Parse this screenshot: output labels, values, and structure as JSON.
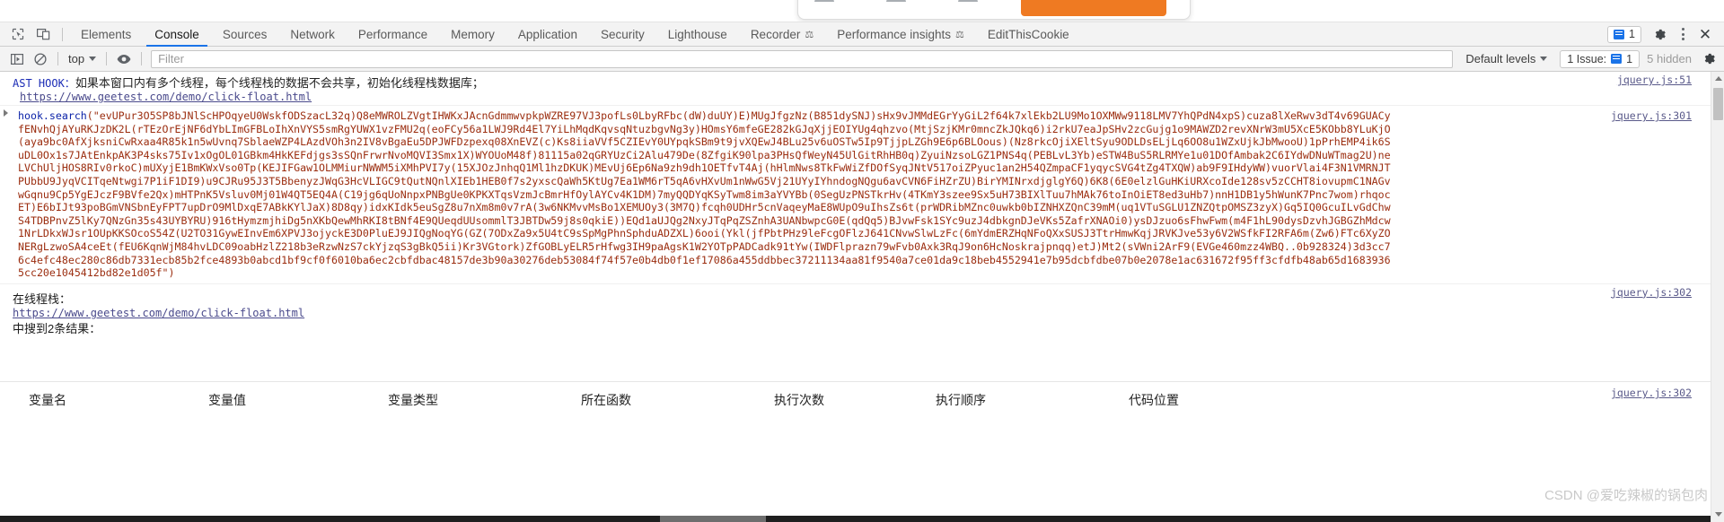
{
  "popup": {
    "orange_button_label": ""
  },
  "tabbar": {
    "inspect_icon": "inspect-cursor-icon",
    "device_icon": "device-toolbar-icon",
    "tabs": [
      {
        "label": "Elements",
        "selected": false,
        "flask": false
      },
      {
        "label": "Console",
        "selected": true,
        "flask": false
      },
      {
        "label": "Sources",
        "selected": false,
        "flask": false
      },
      {
        "label": "Network",
        "selected": false,
        "flask": false
      },
      {
        "label": "Performance",
        "selected": false,
        "flask": false
      },
      {
        "label": "Memory",
        "selected": false,
        "flask": false
      },
      {
        "label": "Application",
        "selected": false,
        "flask": false
      },
      {
        "label": "Security",
        "selected": false,
        "flask": false
      },
      {
        "label": "Lighthouse",
        "selected": false,
        "flask": false
      },
      {
        "label": "Recorder",
        "selected": false,
        "flask": true
      },
      {
        "label": "Performance insights",
        "selected": false,
        "flask": true
      },
      {
        "label": "EditThisCookie",
        "selected": false,
        "flask": false
      }
    ],
    "issue_count": "1",
    "settings_icon": "gear-icon",
    "more_icon": "kebab-menu-icon",
    "close_icon": "close-icon",
    "close_glyph": "✕"
  },
  "toolbar": {
    "clear_icon": "clear-console-icon",
    "noentry_icon": "no-entry-icon",
    "context": "top",
    "eye_icon": "live-expression-eye-icon",
    "filter_placeholder": "Filter",
    "levels_label": "Default levels",
    "issues_label": "1 Issue:",
    "issues_count": "1",
    "hidden_label": "5 hidden",
    "settings_icon": "console-settings-gear-icon"
  },
  "console": {
    "messages": [
      {
        "id": "ast-hook",
        "prefix": "AST HOOK：",
        "text": "如果本窗口内有多个线程，每个线程栈的数据不会共享，初始化线程栈数据库；",
        "source": "jquery.js:51",
        "link": "https://www.geetest.com/demo/click-float.html"
      },
      {
        "id": "hook-search",
        "fn": "hook.search",
        "code": "(\"evUPur3O5SP8bJNlScHPOqyeU0WskfODSzacL32q)Q8eMWROLZVgtIHWKxJAcnGdmmwvpkpWZRE97VJ3pofLs0LbyRFbc(dW)duUY)E)MUgJfgzNz(B851dySNJ)sHx9vJMMdEGrYyGiL2f64k7xlEkb2LU9Mo1OXMWw9118LMV7YhQPdN4xpS)cuza8lXeRwv3dT4v69GUACyfENvhQjAYuRKJzDK2L(rTEzOrEjNF6dYbLImGFBLoIhXnVYS5smRgYUWX1vzFMU2q(eoFCy56a1LWJ9Rd4El7YiLhMqdKqvsqNtuzbgvNg3y)HOmsY6mfeGE282kGJqXjjEOIYUg4qhzvo(MtjSzjKMr0mncZkJQkq6)i2rkU7eaJpSHv2zcGujg1o9MAWZD2revXNrW3mU5XcE5KObb8YLuKjO(aya9bc0AfXjksniCwRxaa4R85k1n5wUvnq7SblaeWZP4LAzdVOh3n2IV8vBgaEu5DPJWFDzpexq08XnEVZ(c)Ks8iiaVVf5CZIEvY0UYpqkSBm9t9jvXQEwJ4BLu25v6uOSTw5Ip9TjjpLZGh9E6p6BLOous)(Nz8rkcOjiXEltSyu9ODLDsELjLq6OO8u1WZxUjkJbMwooU)1pPrhEMP4ik6SuDL0Ox1s7JAtEnkpAK3P4sks75Iv1xOgOL01GBkm4HkKEFdjgs3sSQnFrwrNvoMQVI3Smx1X)WYOUoM48f)81115a02qGRYUzCi2Alu479De(8ZfgiK90lpa3PHsQfWeyN45UlGitRhHB0q)ZyuiNzsoLGZ1PNS4q(PEBLvL3Yb)eSTW4BuS5RLRMYe1u01DOfAmbak2C6IYdwDNuWTmag2U)neLVChUljHOS8RIv0rkoC)mUXyjE1BmKWxVso0Tp(KEJIFGaw1OLMMiurNWWM5iXMhPVI7y(15XJOzJnhqQ1Ml1hzDKUK)MEvUj6Ep6Na9zh9dh1OETfvT4Aj(hHlmNws8TkFwWiZfDOfSyqJNtV517oiZPyuc1an2H54QZmpaCF1yqycSVG4tZg4TXQW)ab9F9IHdyWW)vuorVlai4F3N1VMRNJTPUbbU9JyqVCITqeNtwgi7P1iF1DI9)u9CJRu95J3T5BbenyzJWqG3HcVLIGC9tQutNQnlXIEb1HEB0f7s2yxscQaWh5KtUg7Ea1WM6rT5qA6vHXvUm1nWwG5Vj21UYyIYhndogNQgu6avCVN6FiHZrZU)BirYMINrxdjglgY6Q)6K8(6E0elzlGuHKiURXcoIde128sv5zCCHT8iovupmC1NAGvwGqnu9Cp5YgEJczF9BVfe2Qx)mHTPnK5Vsluv0Mj01W4QT5EQ4A(C19jg6qUoNnpxPNBgUe0KPKXTqsVzmJcBmrHfOylAYCv4K1DM)7myQQDYqKSyTwm8im3aYVYBb(0SegUzPNSTkrHv(4TKmY3szee9Sx5uH73BIXlTuu7hMAk76toInOiET8ed3uHb7)nnH1DB1y5hWunK7Pnc7wom)rhqocET)E6bIJt93poBGmVNSbnEyFPT7upDrO9MlDxqE7ABkKYlJaX)8D8qy)idxKIdk5euSgZ8u7nXm8m0v7rA(3w6NKMvvMsBo1XEMUOy3(3M7Q)fcqh0UDHr5cnVaqeyMaE8WUpO9uIhsZs6t(prWDRibMZnc0uwkb0bIZNHXZQnC39mM(uq1VTuSGLU1ZNZQtpOMSZ3zyX)Gq5IQ0GcuILvGdChwS4TDBPnvZ5lKy7QNzGn35s43UYBYRU)916tHymzmjhiDg5nXKbQewMhRKI8tBNf4E9QUeqdUUsommlT3JBTDw59j8s0qkiE))EQd1aUJQg2NxyJTqPqZSZnhA3UANbwpcG0E(qdQq5)BJvwFsk1SYc9uzJ4dbkgnDJeVKs5ZafrXNAOi0)ysDJzuo6sFhwFwm(m4F1hL90dysDzvhJGBGZhMdcw1NrLDkxWJsr1OUpKKSOcoS54Z(U2TO31GywEInvEm6XPVJ3ojyckE3D0PluEJ9JIQgNoqYG(GZ(7ODxZa9x5U4tC9sSpMgPhnSphduADZXL)6ooi(Ykl(jfPbtPHz9leFcgOFlzJ641CNvwSlwLzFc(6mYdmERZHqNFoQXxSUSJ3TtrHmwKqjJRVKJve53y6V2WSfkFI2RFA6m(Zw6)FTc6XyZONERgLzwoSA4ceEt(fEU6KqnWjM84hvLDC09oabHzlZ218b3eRzwNzS7ckYjzqS3gBkQ5ii)Kr3VGtork)ZfGOBLyELR5rHfwg3IH9paAgsK1W2YOTpPADCadk91tYw(IWDFlprazn79wFvb0Axk3RqJ9on6HcNoskrajpnqq)etJ)Mt2(sVWni2ArF9(EVGe460mzz4WBQ..0b928324)3d3cc76c4efc48ec280c86db7331ecb85b2fce4893b0abcd1bf9cf0f6010ba6ec2cbfdbac48157de3b90a30276deb53084f74f57e0b4db0f1ef17086a455ddbbec37211134aa81f9540a7ce01da9c18beb4552941e7b95dcbfdbe07b0e2078e1ac631672f95ff3cfdfb48ab65d16839365cc20e1045412bd82e1d05f\")",
        "source": "jquery.js:301"
      },
      {
        "id": "online-stack",
        "label": "在线程栈：",
        "link": "https://www.geetest.com/demo/click-float.html",
        "result_text": "中搜到2条结果：",
        "source": "jquery.js:302"
      }
    ]
  },
  "table": {
    "headers": [
      "变量名",
      "变量值",
      "变量类型",
      "所在函数",
      "执行次数",
      "执行顺序",
      "代码位置"
    ]
  },
  "watermark": "CSDN @爱吃辣椒的锅包肉",
  "colors": {
    "accent": "#1a73e8",
    "orange": "#ef7a22",
    "link": "#4a4a8c",
    "toolbar_bg": "#f3f3f3"
  }
}
